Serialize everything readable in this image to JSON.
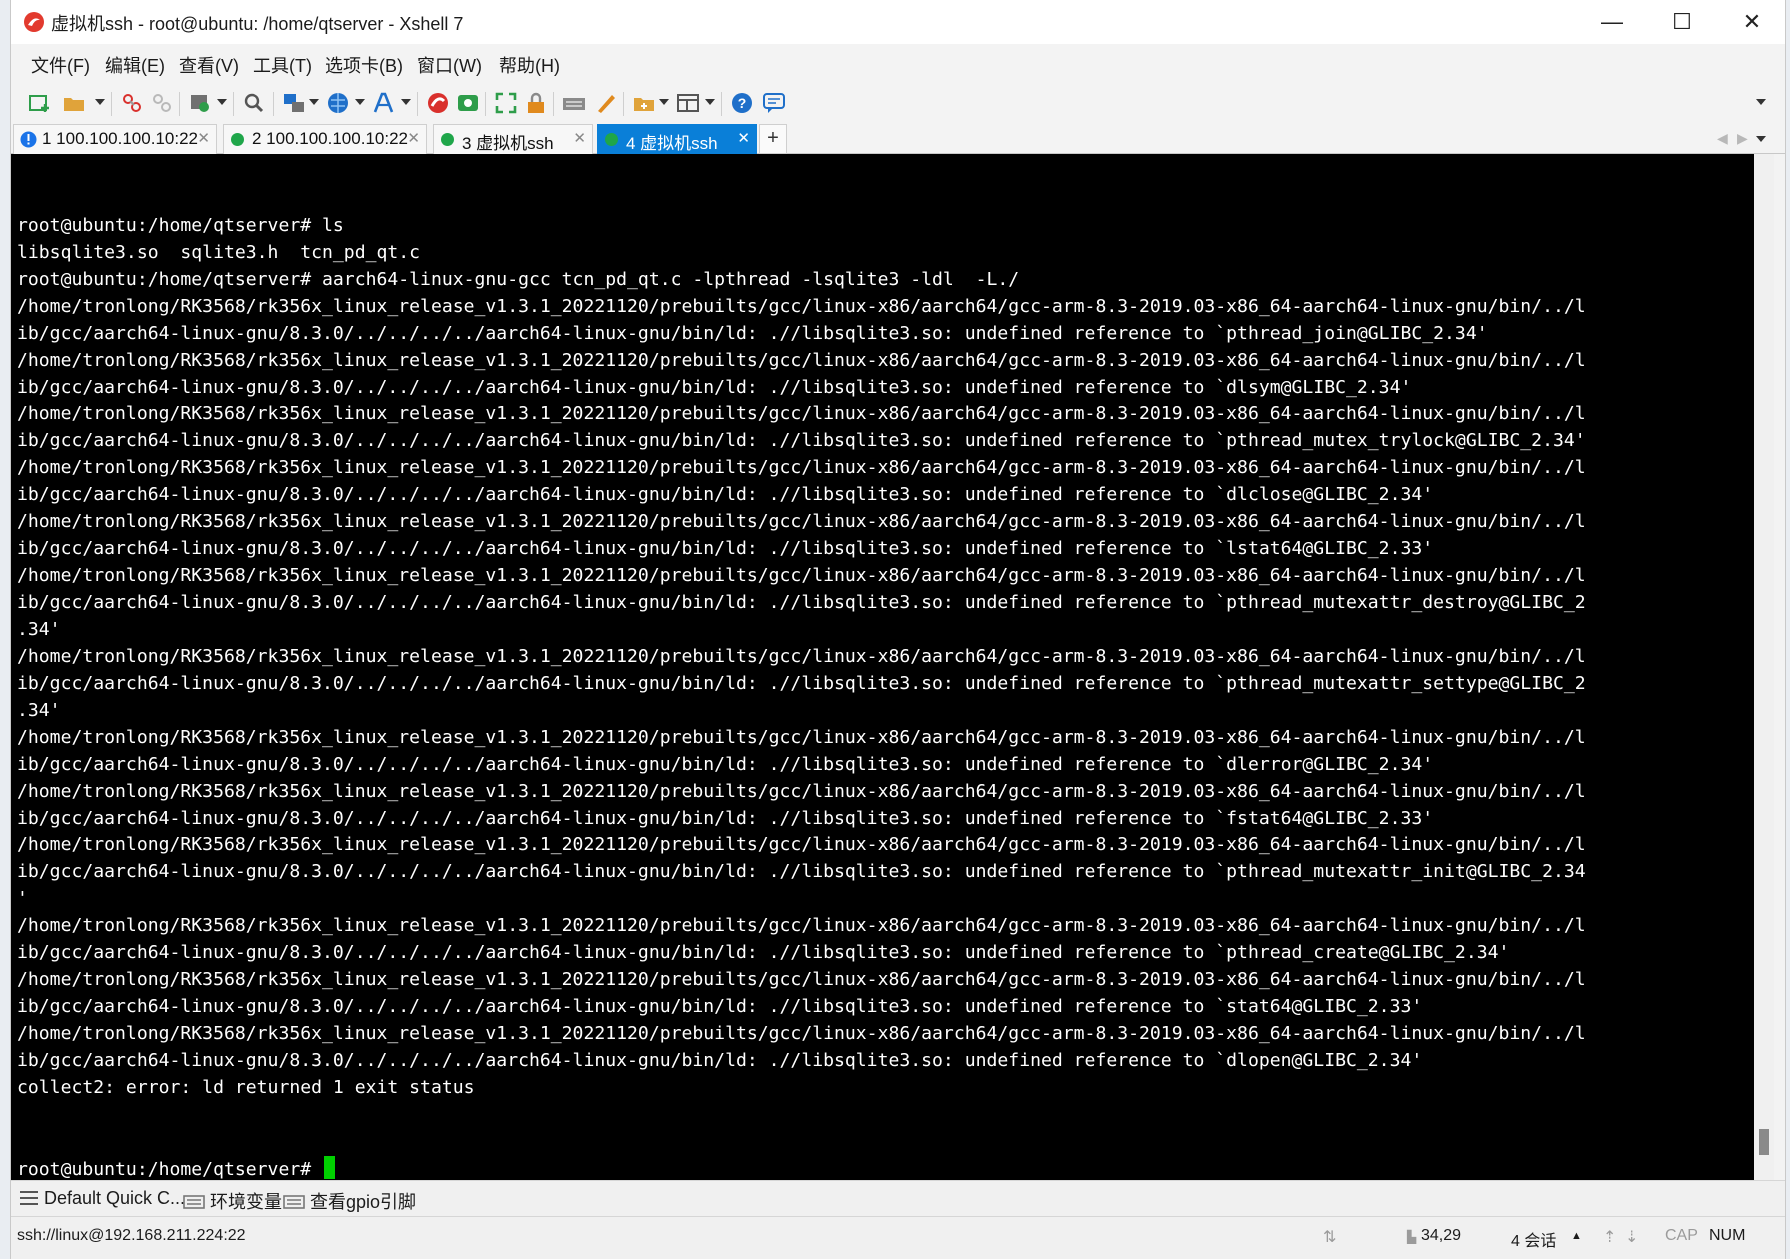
{
  "window": {
    "title": "虚拟机ssh - root@ubuntu: /home/qtserver - Xshell 7",
    "minimize": "—",
    "maximize": "☐",
    "close": "✕"
  },
  "menu": [
    "文件(F)",
    "编辑(E)",
    "查看(V)",
    "工具(T)",
    "选项卡(B)",
    "窗口(W)",
    "帮助(H)"
  ],
  "toolbar": {
    "icons": [
      "new-session-icon",
      "open-folder-icon",
      "reconnect-icon",
      "disconnect-icon",
      "properties-icon",
      "find-icon",
      "transfer-icon",
      "globe-icon",
      "font-icon",
      "xshell-icon",
      "xftp-icon",
      "fullscreen-icon",
      "lock-icon",
      "keyboard-icon",
      "script-icon",
      "compose-icon",
      "layout-icon",
      "help-icon",
      "chat-icon"
    ],
    "colors": {
      "green": "#2e9d4a",
      "blue": "#1f6fc9",
      "red": "#d9302c",
      "orange": "#e08a1e",
      "gray": "#707070"
    }
  },
  "tabs": [
    {
      "label": "1 100.100.100.10:22",
      "status": "alert",
      "dot_color": "#1a73e8"
    },
    {
      "label": "2 100.100.100.10:22",
      "status": "connected",
      "dot_color": "#1fa64a"
    },
    {
      "label": "3 虚拟机ssh",
      "status": "connected",
      "dot_color": "#1fa64a"
    },
    {
      "label": "4 虚拟机ssh",
      "status": "active",
      "dot_color": "#1fa64a"
    }
  ],
  "tab_close": "✕",
  "tab_add": "+",
  "terminal": {
    "lines": [
      "root@ubuntu:/home/qtserver# ls",
      "libsqlite3.so  sqlite3.h  tcn_pd_qt.c",
      "root@ubuntu:/home/qtserver# aarch64-linux-gnu-gcc tcn_pd_qt.c -lpthread -lsqlite3 -ldl  -L./",
      "/home/tronlong/RK3568/rk356x_linux_release_v1.3.1_20221120/prebuilts/gcc/linux-x86/aarch64/gcc-arm-8.3-2019.03-x86_64-aarch64-linux-gnu/bin/../l",
      "ib/gcc/aarch64-linux-gnu/8.3.0/../../../../aarch64-linux-gnu/bin/ld: .//libsqlite3.so: undefined reference to `pthread_join@GLIBC_2.34'",
      "/home/tronlong/RK3568/rk356x_linux_release_v1.3.1_20221120/prebuilts/gcc/linux-x86/aarch64/gcc-arm-8.3-2019.03-x86_64-aarch64-linux-gnu/bin/../l",
      "ib/gcc/aarch64-linux-gnu/8.3.0/../../../../aarch64-linux-gnu/bin/ld: .//libsqlite3.so: undefined reference to `dlsym@GLIBC_2.34'",
      "/home/tronlong/RK3568/rk356x_linux_release_v1.3.1_20221120/prebuilts/gcc/linux-x86/aarch64/gcc-arm-8.3-2019.03-x86_64-aarch64-linux-gnu/bin/../l",
      "ib/gcc/aarch64-linux-gnu/8.3.0/../../../../aarch64-linux-gnu/bin/ld: .//libsqlite3.so: undefined reference to `pthread_mutex_trylock@GLIBC_2.34'",
      "/home/tronlong/RK3568/rk356x_linux_release_v1.3.1_20221120/prebuilts/gcc/linux-x86/aarch64/gcc-arm-8.3-2019.03-x86_64-aarch64-linux-gnu/bin/../l",
      "ib/gcc/aarch64-linux-gnu/8.3.0/../../../../aarch64-linux-gnu/bin/ld: .//libsqlite3.so: undefined reference to `dlclose@GLIBC_2.34'",
      "/home/tronlong/RK3568/rk356x_linux_release_v1.3.1_20221120/prebuilts/gcc/linux-x86/aarch64/gcc-arm-8.3-2019.03-x86_64-aarch64-linux-gnu/bin/../l",
      "ib/gcc/aarch64-linux-gnu/8.3.0/../../../../aarch64-linux-gnu/bin/ld: .//libsqlite3.so: undefined reference to `lstat64@GLIBC_2.33'",
      "/home/tronlong/RK3568/rk356x_linux_release_v1.3.1_20221120/prebuilts/gcc/linux-x86/aarch64/gcc-arm-8.3-2019.03-x86_64-aarch64-linux-gnu/bin/../l",
      "ib/gcc/aarch64-linux-gnu/8.3.0/../../../../aarch64-linux-gnu/bin/ld: .//libsqlite3.so: undefined reference to `pthread_mutexattr_destroy@GLIBC_2",
      ".34'",
      "/home/tronlong/RK3568/rk356x_linux_release_v1.3.1_20221120/prebuilts/gcc/linux-x86/aarch64/gcc-arm-8.3-2019.03-x86_64-aarch64-linux-gnu/bin/../l",
      "ib/gcc/aarch64-linux-gnu/8.3.0/../../../../aarch64-linux-gnu/bin/ld: .//libsqlite3.so: undefined reference to `pthread_mutexattr_settype@GLIBC_2",
      ".34'",
      "/home/tronlong/RK3568/rk356x_linux_release_v1.3.1_20221120/prebuilts/gcc/linux-x86/aarch64/gcc-arm-8.3-2019.03-x86_64-aarch64-linux-gnu/bin/../l",
      "ib/gcc/aarch64-linux-gnu/8.3.0/../../../../aarch64-linux-gnu/bin/ld: .//libsqlite3.so: undefined reference to `dlerror@GLIBC_2.34'",
      "/home/tronlong/RK3568/rk356x_linux_release_v1.3.1_20221120/prebuilts/gcc/linux-x86/aarch64/gcc-arm-8.3-2019.03-x86_64-aarch64-linux-gnu/bin/../l",
      "ib/gcc/aarch64-linux-gnu/8.3.0/../../../../aarch64-linux-gnu/bin/ld: .//libsqlite3.so: undefined reference to `fstat64@GLIBC_2.33'",
      "/home/tronlong/RK3568/rk356x_linux_release_v1.3.1_20221120/prebuilts/gcc/linux-x86/aarch64/gcc-arm-8.3-2019.03-x86_64-aarch64-linux-gnu/bin/../l",
      "ib/gcc/aarch64-linux-gnu/8.3.0/../../../../aarch64-linux-gnu/bin/ld: .//libsqlite3.so: undefined reference to `pthread_mutexattr_init@GLIBC_2.34",
      "'",
      "/home/tronlong/RK3568/rk356x_linux_release_v1.3.1_20221120/prebuilts/gcc/linux-x86/aarch64/gcc-arm-8.3-2019.03-x86_64-aarch64-linux-gnu/bin/../l",
      "ib/gcc/aarch64-linux-gnu/8.3.0/../../../../aarch64-linux-gnu/bin/ld: .//libsqlite3.so: undefined reference to `pthread_create@GLIBC_2.34'",
      "/home/tronlong/RK3568/rk356x_linux_release_v1.3.1_20221120/prebuilts/gcc/linux-x86/aarch64/gcc-arm-8.3-2019.03-x86_64-aarch64-linux-gnu/bin/../l",
      "ib/gcc/aarch64-linux-gnu/8.3.0/../../../../aarch64-linux-gnu/bin/ld: .//libsqlite3.so: undefined reference to `stat64@GLIBC_2.33'",
      "/home/tronlong/RK3568/rk356x_linux_release_v1.3.1_20221120/prebuilts/gcc/linux-x86/aarch64/gcc-arm-8.3-2019.03-x86_64-aarch64-linux-gnu/bin/../l",
      "ib/gcc/aarch64-linux-gnu/8.3.0/../../../../aarch64-linux-gnu/bin/ld: .//libsqlite3.so: undefined reference to `dlopen@GLIBC_2.34'",
      "collect2: error: ld returned 1 exit status"
    ],
    "prompt": "root@ubuntu:/home/qtserver# ",
    "cursor_color": "#00d000"
  },
  "quickbar": {
    "items": [
      "Default Quick C...",
      "环境变量",
      "查看gpio引脚"
    ]
  },
  "statusbar": {
    "connection": "ssh://linux@192.168.211.224:22",
    "position": "34,29",
    "sessions": "4 会话",
    "cap": "CAP",
    "num": "NUM"
  }
}
